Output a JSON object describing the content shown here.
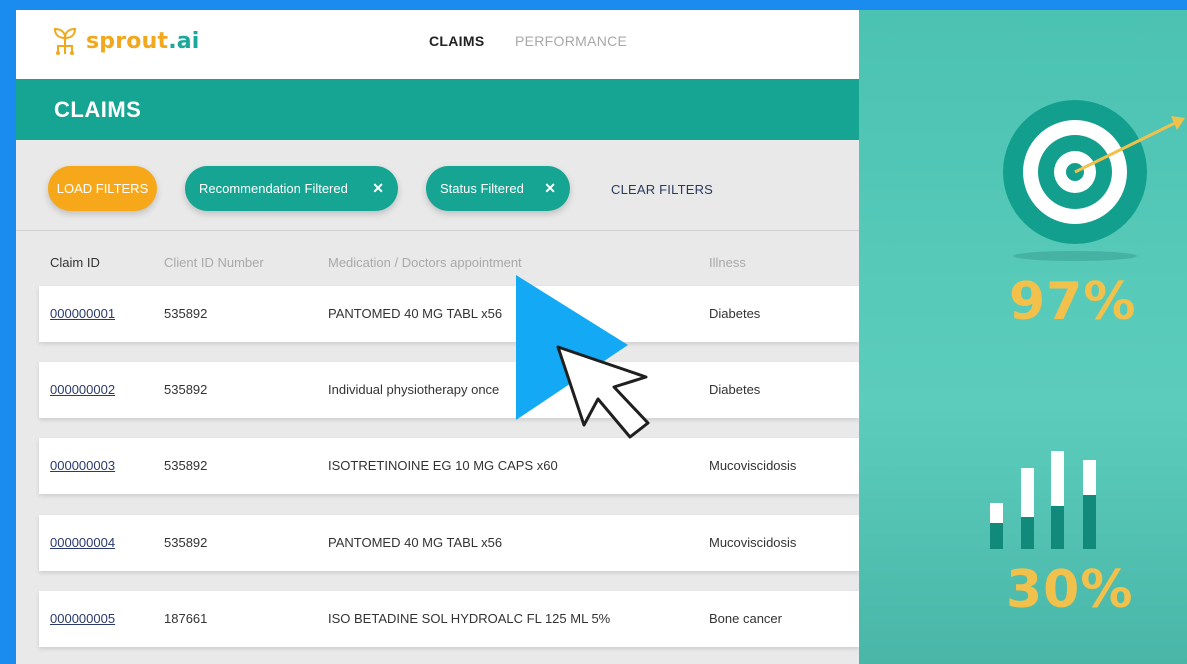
{
  "app": {
    "logo_prefix": "sprout",
    "logo_dot": ".",
    "logo_suffix": "ai"
  },
  "nav": {
    "claims": "CLAIMS",
    "performance": "PERFORMANCE"
  },
  "page": {
    "title": "CLAIMS"
  },
  "filters": {
    "load_label": "LOAD FILTERS",
    "chips": [
      {
        "label": "Recommendation Filtered",
        "close": "✕"
      },
      {
        "label": "Status Filtered",
        "close": "✕"
      }
    ],
    "clear_label": "CLEAR FILTERS"
  },
  "table": {
    "columns": [
      "Claim ID",
      "Client ID Number",
      "Medication / Doctors appointment",
      "Illness"
    ],
    "rows": [
      {
        "claim_id": "000000001",
        "client_id": "535892",
        "medication": "PANTOMED 40 MG TABL x56",
        "illness": "Diabetes"
      },
      {
        "claim_id": "000000002",
        "client_id": "535892",
        "medication": "Individual physiotherapy once",
        "illness": "Diabetes"
      },
      {
        "claim_id": "000000003",
        "client_id": "535892",
        "medication": "ISOTRETINOINE EG 10 MG CAPS x60",
        "illness": "Mucoviscidosis"
      },
      {
        "claim_id": "000000004",
        "client_id": "535892",
        "medication": "PANTOMED 40 MG TABL x56",
        "illness": "Mucoviscidosis"
      },
      {
        "claim_id": "000000005",
        "client_id": "187661",
        "medication": "ISO BETADINE SOL HYDROALC FL 125 ML 5%",
        "illness": "Bone cancer"
      }
    ]
  },
  "stats": {
    "accuracy": "97%",
    "reduction": "30%"
  },
  "colors": {
    "brand_teal": "#17a593",
    "brand_orange": "#f6a81a",
    "stat_yellow": "#f2c14b",
    "play_blue": "#14a9f4"
  }
}
